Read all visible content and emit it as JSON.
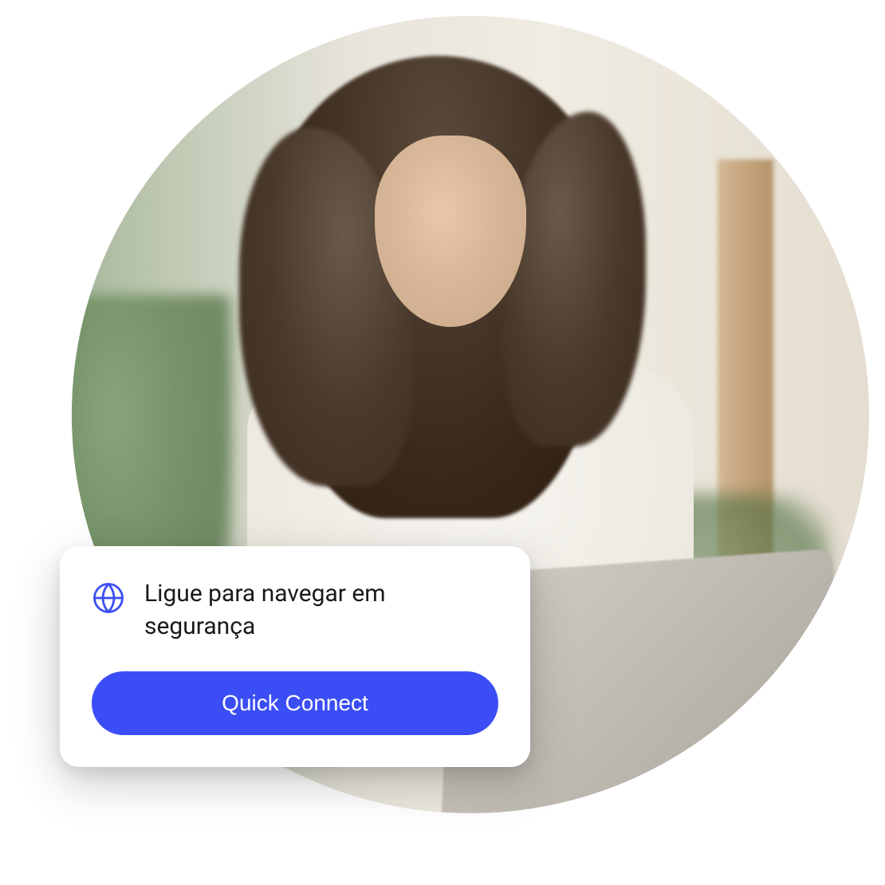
{
  "card": {
    "title": "Ligue para navegar em segurança",
    "button_label": "Quick Connect",
    "icon": "globe-icon"
  },
  "colors": {
    "accent": "#3b4ef5",
    "text": "#1a1a1a",
    "card_bg": "#ffffff"
  }
}
